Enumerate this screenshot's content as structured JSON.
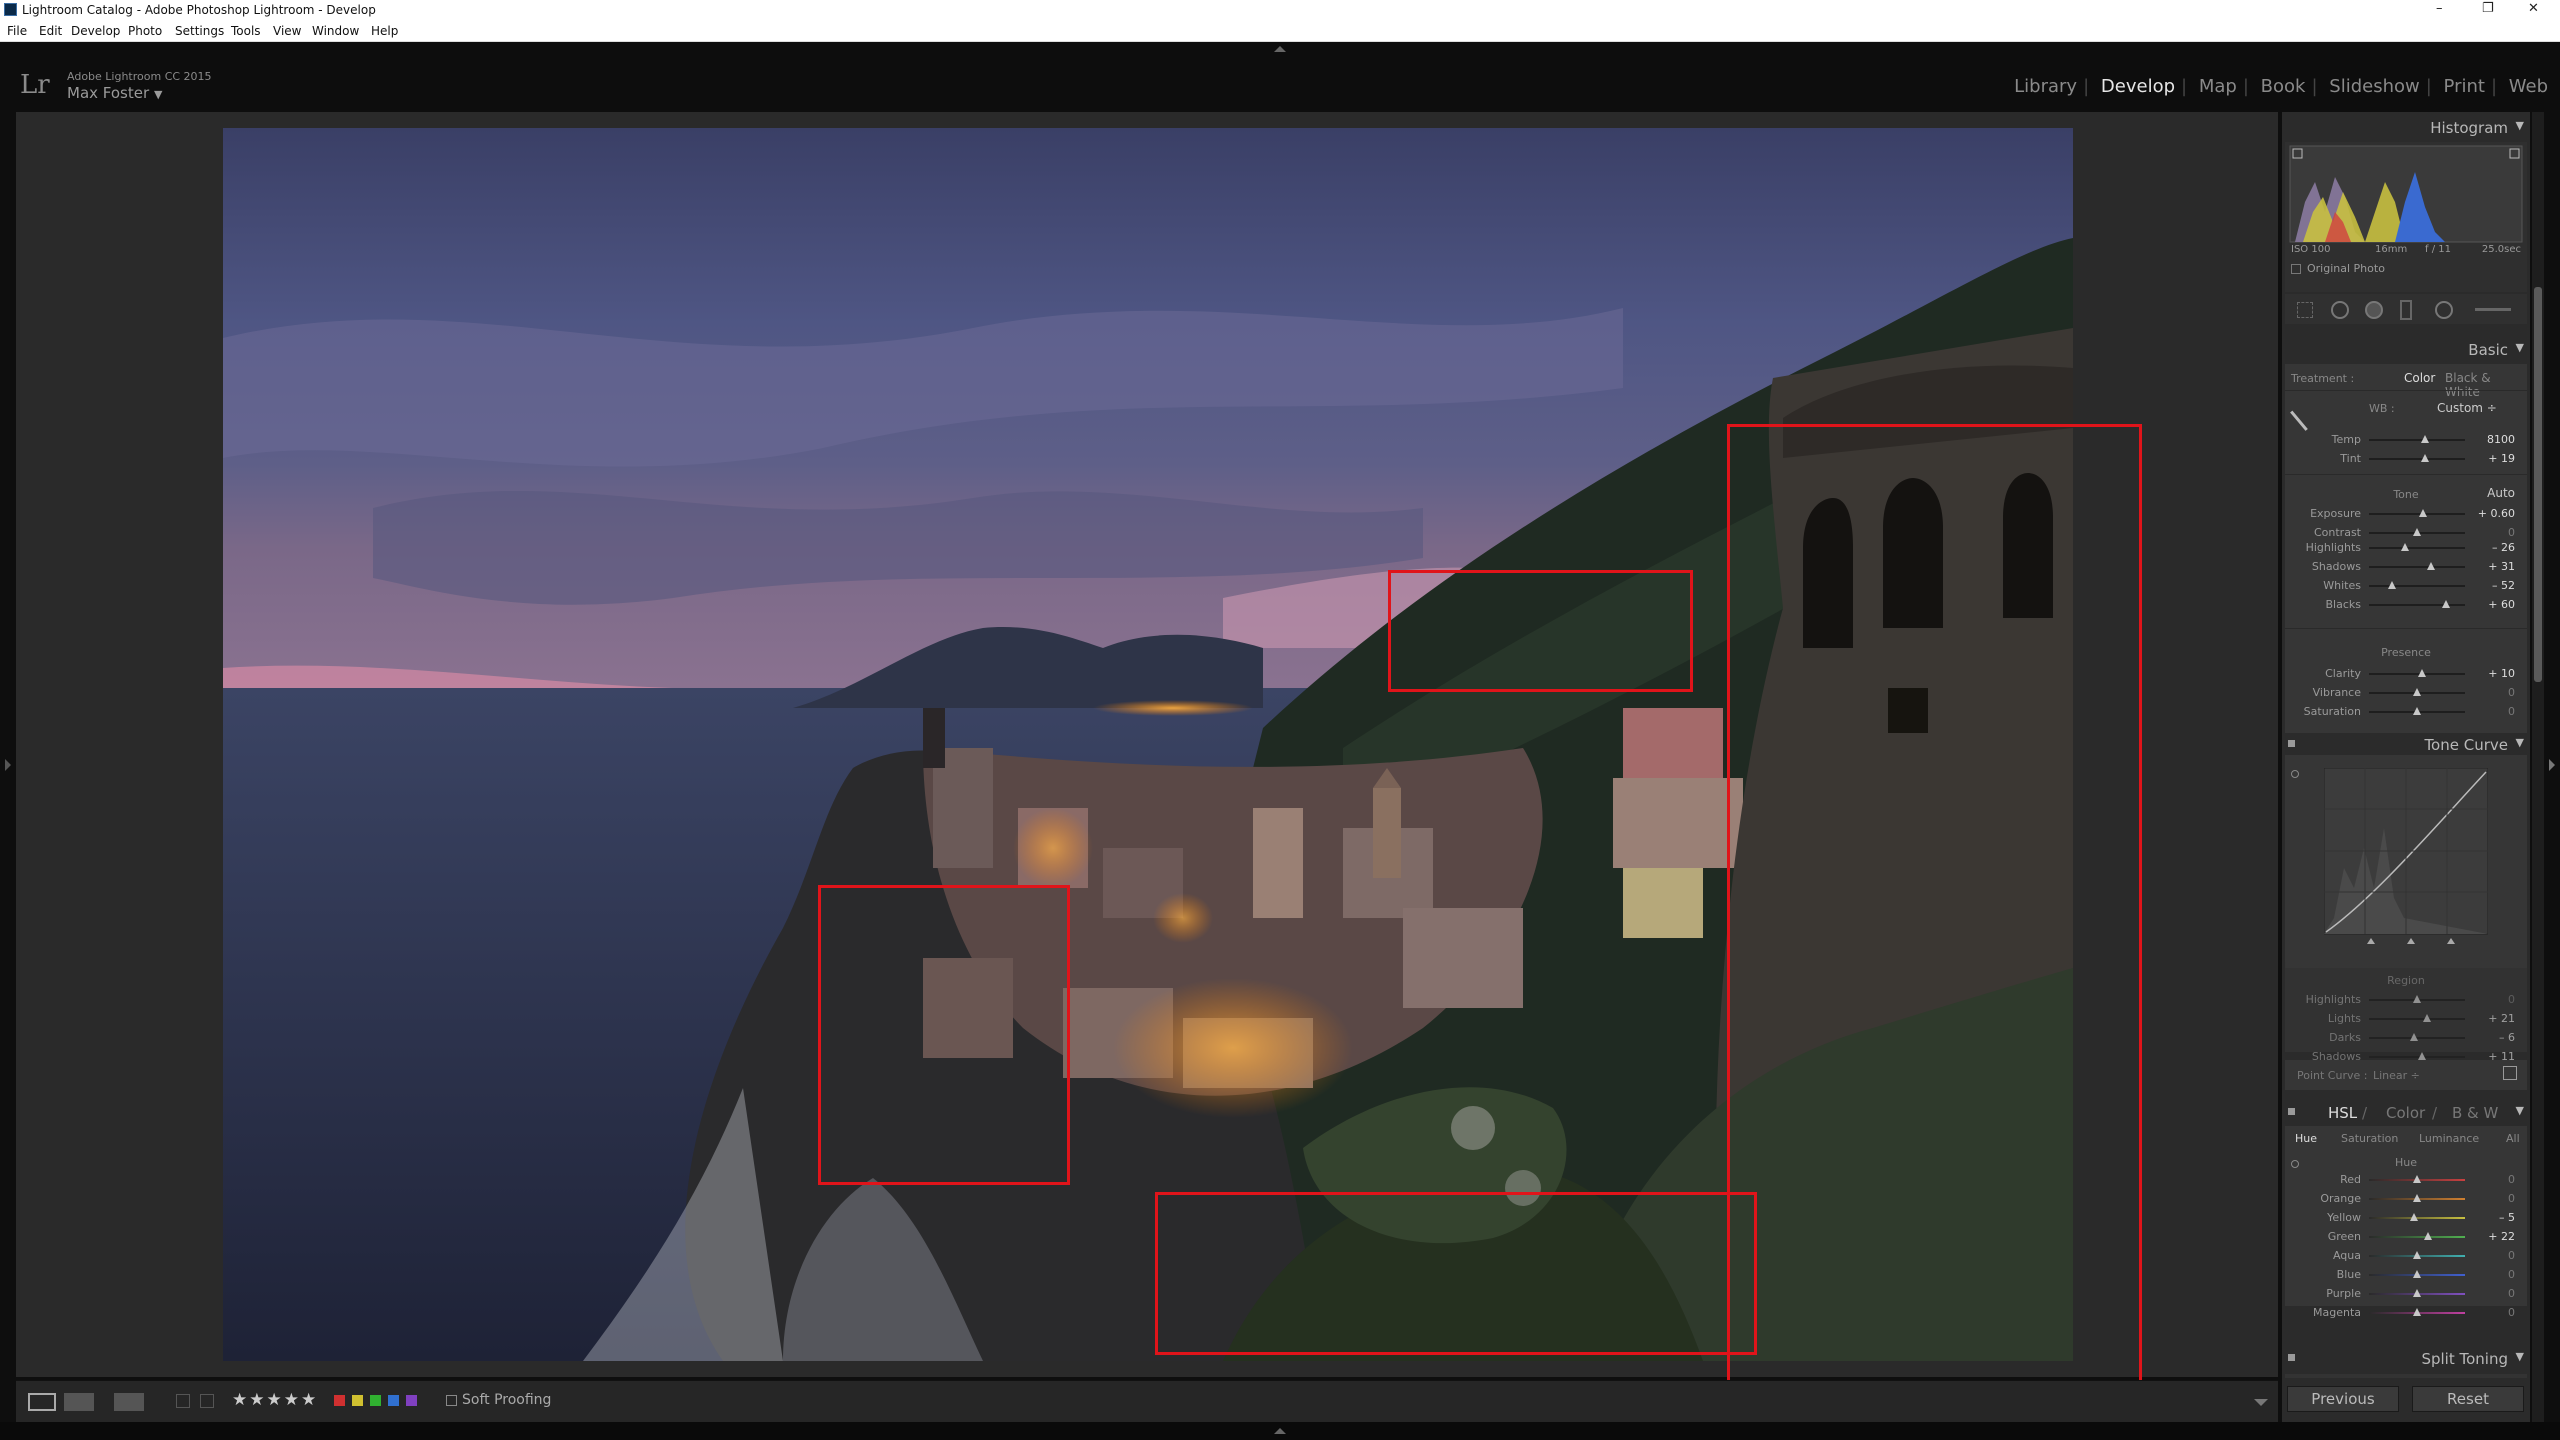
{
  "window": {
    "title": "Lightroom Catalog - Adobe Photoshop Lightroom - Develop",
    "controls": [
      "–",
      "❐",
      "✕"
    ]
  },
  "menu": [
    "File",
    "Edit",
    "Develop",
    "Photo",
    "Settings",
    "Tools",
    "View",
    "Window",
    "Help"
  ],
  "identity": {
    "logo": "Lr",
    "product": "Adobe Lightroom CC 2015",
    "user": "Max Foster",
    "caret": "▼"
  },
  "modules": {
    "items": [
      "Library",
      "Develop",
      "Map",
      "Book",
      "Slideshow",
      "Print",
      "Web"
    ],
    "active": "Develop"
  },
  "histogram": {
    "title": "Histogram",
    "iso": "ISO 100",
    "focal": "16mm",
    "aperture": "f / 11",
    "shutter": "25.0sec",
    "original_photo": "Original Photo"
  },
  "basic": {
    "title": "Basic",
    "treatment_label": "Treatment :",
    "color": "Color",
    "bw": "Black & White",
    "wb_label": "WB :",
    "wb_value": "Custom ÷",
    "tone_label": "Tone",
    "auto": "Auto",
    "presence_label": "Presence",
    "wb_sliders": [
      {
        "label": "Temp",
        "value": "8100",
        "pos": 0.58
      },
      {
        "label": "Tint",
        "value": "+ 19",
        "pos": 0.58
      }
    ],
    "tone_sliders": [
      {
        "label": "Exposure",
        "value": "+ 0.60",
        "pos": 0.56
      },
      {
        "label": "Contrast",
        "value": "0",
        "pos": 0.5
      }
    ],
    "tone_sliders2": [
      {
        "label": "Highlights",
        "value": "– 26",
        "pos": 0.37
      },
      {
        "label": "Shadows",
        "value": "+ 31",
        "pos": 0.65
      },
      {
        "label": "Whites",
        "value": "– 52",
        "pos": 0.24
      },
      {
        "label": "Blacks",
        "value": "+ 60",
        "pos": 0.8
      }
    ],
    "presence_sliders": [
      {
        "label": "Clarity",
        "value": "+ 10",
        "pos": 0.55
      },
      {
        "label": "Vibrance",
        "value": "0",
        "pos": 0.5
      },
      {
        "label": "Saturation",
        "value": "0",
        "pos": 0.5
      }
    ]
  },
  "tone_curve": {
    "title": "Tone Curve",
    "region": "Region",
    "sliders": [
      {
        "label": "Highlights",
        "value": "0",
        "pos": 0.5
      },
      {
        "label": "Lights",
        "value": "+ 21",
        "pos": 0.6
      },
      {
        "label": "Darks",
        "value": "– 6",
        "pos": 0.47
      },
      {
        "label": "Shadows",
        "value": "+ 11",
        "pos": 0.55
      }
    ],
    "point_curve_label": "Point Curve :",
    "point_curve_value": "Linear ÷"
  },
  "hsl": {
    "title_hsl": "HSL",
    "sep1": "/",
    "title_color": "Color",
    "sep2": "/",
    "title_bw": "B & W",
    "tabs": [
      "Hue",
      "Saturation",
      "Luminance",
      "All"
    ],
    "section": "Hue",
    "sliders": [
      {
        "label": "Red",
        "value": "0",
        "pos": 0.5,
        "color": "#c84040"
      },
      {
        "label": "Orange",
        "value": "0",
        "pos": 0.5,
        "color": "#d08030"
      },
      {
        "label": "Yellow",
        "value": "– 5",
        "pos": 0.47,
        "color": "#c8c040"
      },
      {
        "label": "Green",
        "value": "+ 22",
        "pos": 0.61,
        "color": "#50b050"
      },
      {
        "label": "Aqua",
        "value": "0",
        "pos": 0.5,
        "color": "#40b0b0"
      },
      {
        "label": "Blue",
        "value": "0",
        "pos": 0.5,
        "color": "#4060d0"
      },
      {
        "label": "Purple",
        "value": "0",
        "pos": 0.5,
        "color": "#8050c0"
      },
      {
        "label": "Magenta",
        "value": "0",
        "pos": 0.5,
        "color": "#c040a0"
      }
    ]
  },
  "split_toning": {
    "title": "Split Toning"
  },
  "buttons": {
    "previous": "Previous",
    "reset": "Reset"
  },
  "toolbar": {
    "stars": "★★★★★",
    "soft_proofing": "Soft Proofing",
    "labels": [
      "#d03030",
      "#d0c030",
      "#30b030",
      "#3070d0",
      "#8040c0"
    ]
  }
}
